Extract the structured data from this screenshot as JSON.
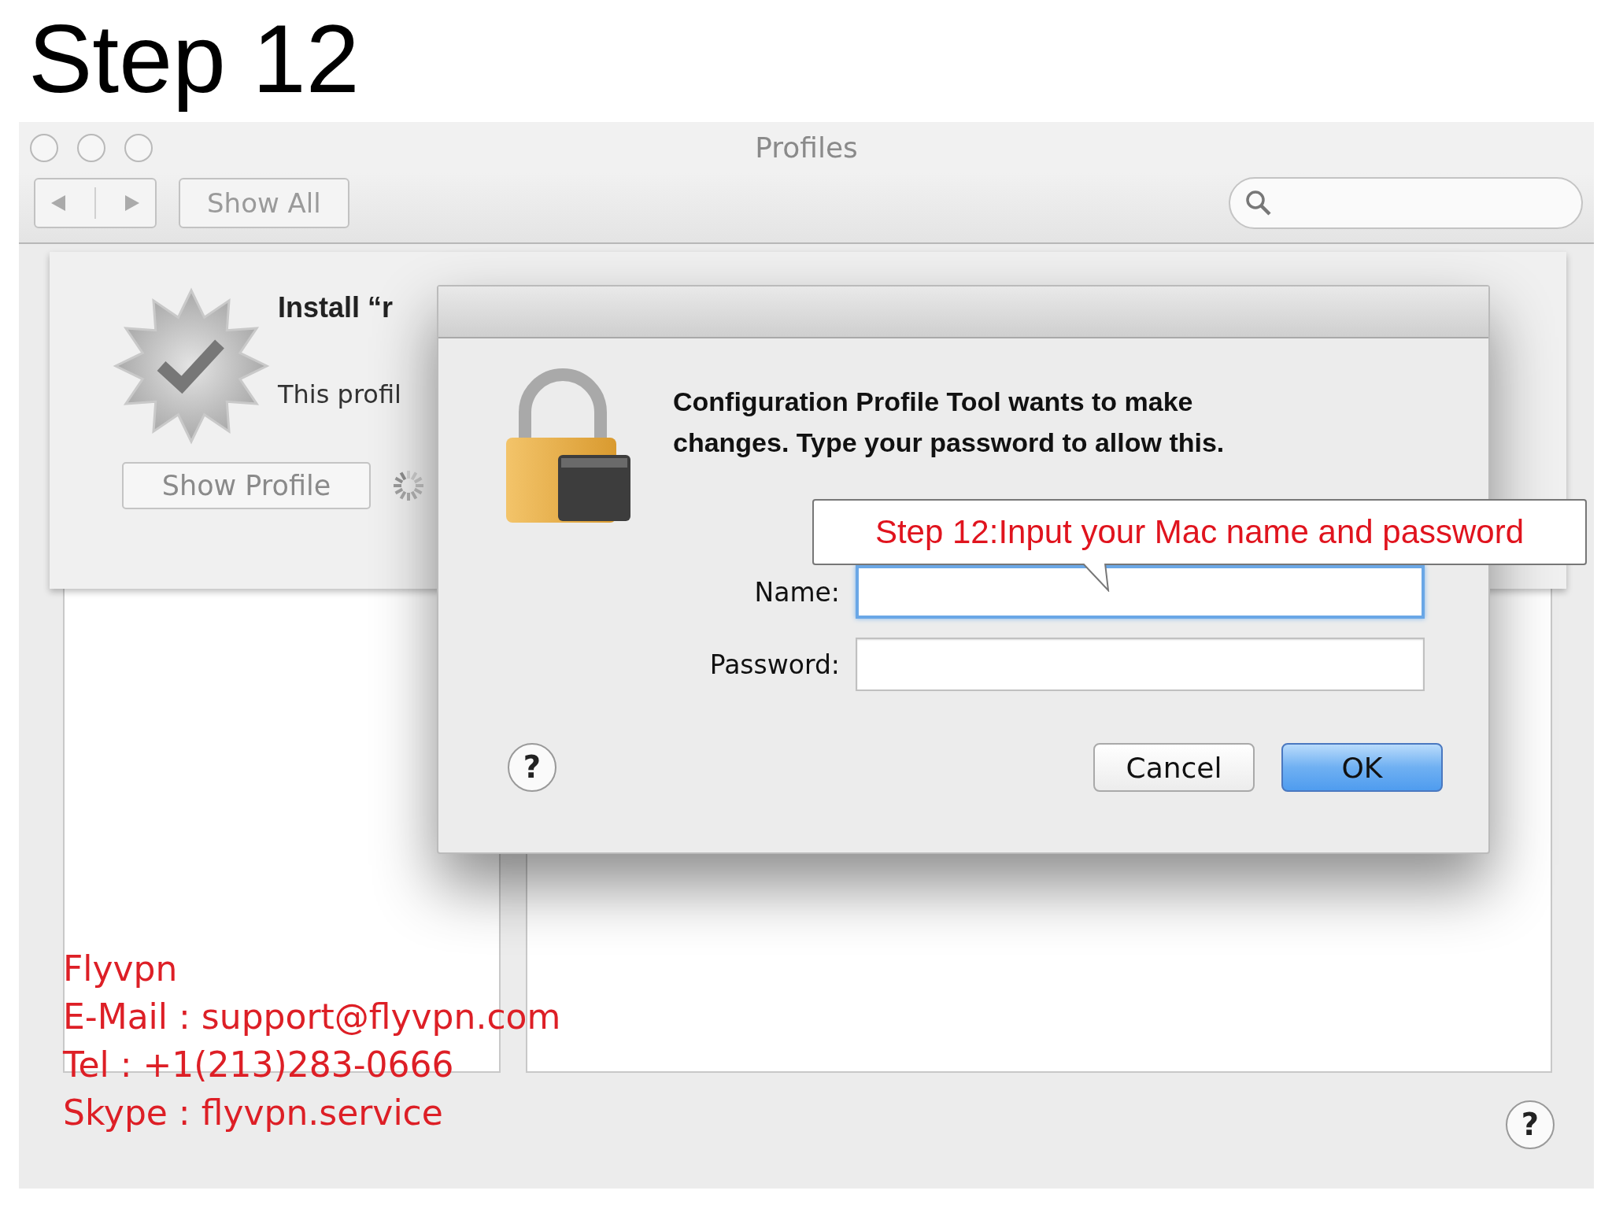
{
  "heading": "Step 12",
  "window": {
    "title": "Profiles",
    "show_all": "Show All"
  },
  "profile_sheet": {
    "title": "Install “r",
    "description": "This profil",
    "show_profile": "Show Profile"
  },
  "dialog": {
    "message": "Configuration Profile Tool wants to make changes. Type your password to allow this.",
    "fields": [
      {
        "label": "Name:",
        "focused": true
      },
      {
        "label": "Password:",
        "focused": false
      }
    ],
    "buttons": [
      {
        "label": "Cancel",
        "default": false
      },
      {
        "label": "OK",
        "default": true
      }
    ]
  },
  "help_buttons": {
    "window": "?",
    "dialog": "?"
  },
  "callout": "Step 12:Input your Mac name and password",
  "contact": [
    "Flyvpn",
    "E-Mail : support@flyvpn.com",
    "Tel : +1(213)283-0666",
    "Skype : flyvpn.service"
  ]
}
